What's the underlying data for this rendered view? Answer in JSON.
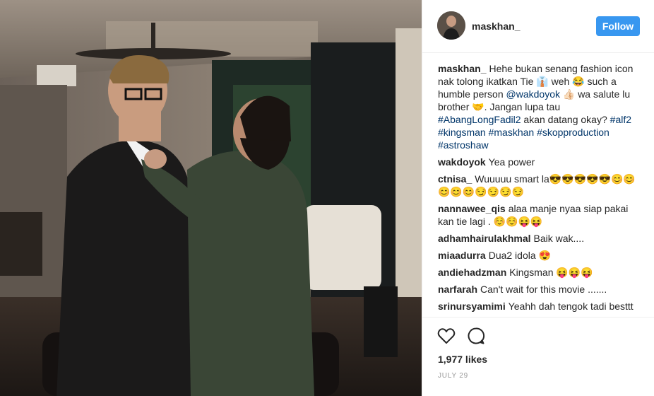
{
  "post": {
    "username": "maskhan_",
    "follow_label": "Follow",
    "caption": {
      "user": "maskhan_",
      "text_1": "Hehe bukan senang fashion icon nak tolong ikatkan Tie 👔 weh 😂 such a humble person ",
      "mention": "@wakdoyok",
      "text_2": " 👍🏻 wa salute lu brother 🤝. Jangan lupa tau ",
      "tag_1": "#AbangLongFadil2",
      "text_3": " akan datang okay? ",
      "tag_2": "#alf2",
      "tag_3": "#kingsman",
      "tag_4": "#maskhan",
      "tag_5": "#skopproduction",
      "tag_6": "#astroshaw"
    },
    "comments": [
      {
        "user": "wakdoyok",
        "text": "Yea power"
      },
      {
        "user": "ctnisa_",
        "text": "Wuuuuu smart la😎😎😎😎😎😊😊😊😊😊😏😏😏😏"
      },
      {
        "user": "nannawee_qis",
        "text": "alaa manje nyaa siap pakai kan tie lagi . ☺️☺️😝😝"
      },
      {
        "user": "adhamhairulakhmal",
        "text": "Baik wak...."
      },
      {
        "user": "miaadurra",
        "text": "Dua2 idola 😍"
      },
      {
        "user": "andiehadzman",
        "text": "Kingsman 😝😝😝"
      },
      {
        "user": "narfarah",
        "text": "Can't wait for this movie ......."
      },
      {
        "user": "srinursyamimi",
        "text": "Yeahh dah tengok tadi besttt"
      }
    ],
    "likes": "1,977 likes",
    "date": "JULY 29"
  },
  "icons": {
    "like": "heart-icon",
    "comment": "speech-bubble-icon"
  },
  "colors": {
    "follow_button": "#3897f0",
    "link": "#003569",
    "muted": "#999999"
  }
}
